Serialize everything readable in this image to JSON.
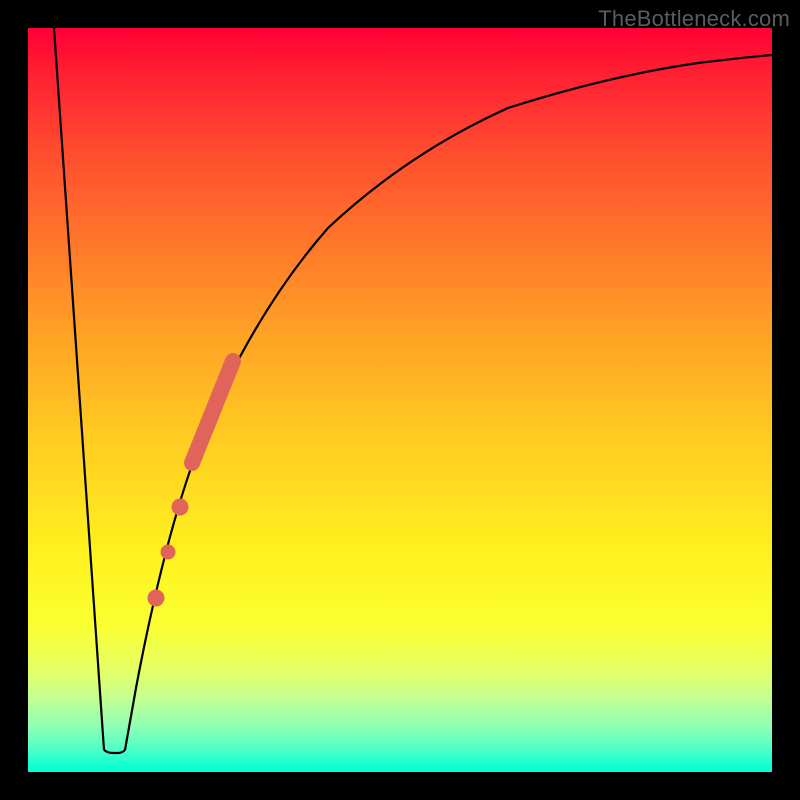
{
  "watermark": "TheBottleneck.com",
  "chart_data": {
    "type": "line",
    "title": "",
    "xlabel": "",
    "ylabel": "",
    "xlim": [
      0,
      100
    ],
    "ylim": [
      0,
      100
    ],
    "grid": false,
    "legend": false,
    "background_gradient": {
      "top": "#ff0034",
      "mid_upper": "#ff7b2a",
      "mid": "#ffce21",
      "mid_lower": "#fff01e",
      "bottom": "#00ffd0"
    },
    "series": [
      {
        "name": "bottleneck-curve-left",
        "description": "steep descending line from top-left to valley",
        "color": "#000000",
        "stroke_width": 2,
        "x": [
          3.5,
          10.2
        ],
        "y": [
          100,
          2.9
        ]
      },
      {
        "name": "bottleneck-curve-valley",
        "description": "flat valley floor",
        "color": "#000000",
        "stroke_width": 2,
        "x": [
          10.2,
          12.5
        ],
        "y": [
          2.9,
          2.9
        ]
      },
      {
        "name": "bottleneck-curve-right",
        "description": "asymptotic rising curve from valley toward 100",
        "color": "#000000",
        "stroke_width": 2,
        "x": [
          12.5,
          14,
          16,
          18,
          20,
          22,
          24,
          27,
          30,
          34,
          38,
          44,
          52,
          62,
          75,
          88,
          100
        ],
        "y": [
          2.9,
          10,
          20,
          28,
          35,
          41,
          47,
          54,
          60,
          66,
          71,
          77,
          82.5,
          87,
          90.5,
          93,
          94.5
        ]
      },
      {
        "name": "highlight-segment",
        "description": "thick salmon segment on rising curve",
        "color": "#e0645a",
        "stroke_width": 16,
        "linecap": "round",
        "x": [
          22.4,
          28.1
        ],
        "y": [
          42.5,
          56.0
        ]
      },
      {
        "name": "highlight-dots",
        "description": "discrete salmon dots below the segment",
        "type": "scatter",
        "color": "#e0645a",
        "radius": 7,
        "x": [
          20.6,
          19.0,
          17.4
        ],
        "y": [
          36.8,
          30.5,
          24.0
        ]
      }
    ]
  }
}
